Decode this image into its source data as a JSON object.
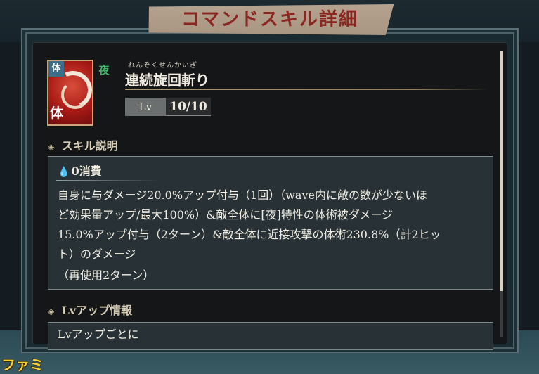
{
  "header": {
    "title": "コマンドスキル詳細"
  },
  "skill": {
    "icon_tags": {
      "type_top": "体",
      "attribute": "夜",
      "type_bottom": "体"
    },
    "ruby": "れんぞくせんかいぎ",
    "name": "連続旋回斬り",
    "level_label": "Lv",
    "level_value": "10/10"
  },
  "sections": {
    "description_heading": "スキル説明",
    "lvup_heading": "Lvアップ情報"
  },
  "description": {
    "cost": "0消費",
    "lines": [
      "自身に与ダメージ20.0%アップ付与（1回）（wave内に敵の数が少ないほ",
      "ど効果量アップ/最大100%）&敵全体に[夜]特性の体術被ダメージ",
      "15.0%アップ付与（2ターン）&敵全体に近接攻撃の体術230.8%（計2ヒッ",
      "ト）のダメージ",
      "（再使用2ターン）"
    ]
  },
  "lvup": {
    "text": "Lvアップごとに"
  },
  "watermark": "ファミ通.com",
  "icons": {
    "section_marker": "diamond-icon",
    "cost": "water-drop-icon"
  },
  "colors": {
    "title": "#8b2620",
    "banner": "#b5a390",
    "panel": "#151617",
    "box": "#283236",
    "cost_icon": "#62b9df",
    "attribute_night": "#42b76b"
  }
}
